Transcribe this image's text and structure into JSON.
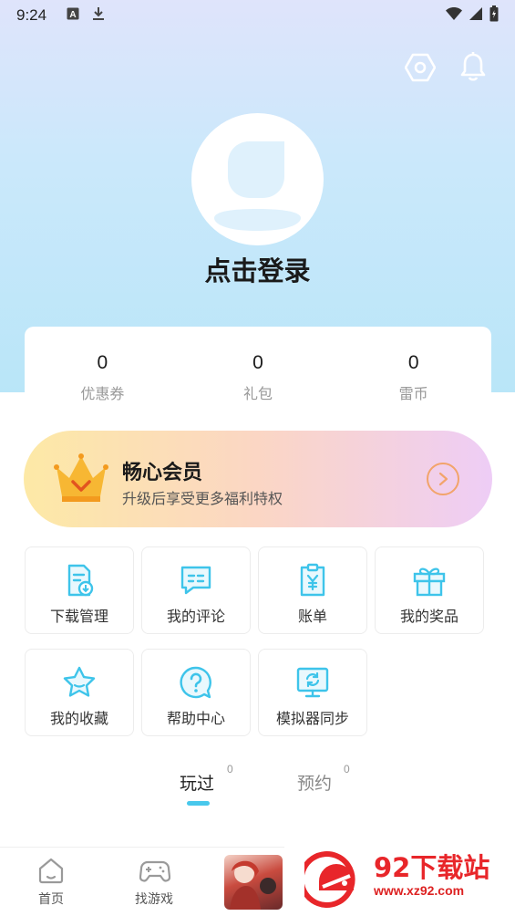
{
  "status_bar": {
    "time": "9:24"
  },
  "icons": {
    "settings": "settings-hex-icon",
    "notification": "bell-icon"
  },
  "profile": {
    "login_label": "点击登录"
  },
  "stats": [
    {
      "value": "0",
      "label": "优惠券"
    },
    {
      "value": "0",
      "label": "礼包"
    },
    {
      "value": "0",
      "label": "雷币"
    }
  ],
  "vip": {
    "title": "畅心会员",
    "subtitle": "升级后享受更多福利特权"
  },
  "menu": [
    {
      "label": "下载管理",
      "icon": "download-doc-icon"
    },
    {
      "label": "我的评论",
      "icon": "comment-icon"
    },
    {
      "label": "账单",
      "icon": "bill-icon"
    },
    {
      "label": "我的奖品",
      "icon": "gift-icon"
    },
    {
      "label": "我的收藏",
      "icon": "star-icon"
    },
    {
      "label": "帮助中心",
      "icon": "help-icon"
    },
    {
      "label": "模拟器同步",
      "icon": "sync-monitor-icon"
    }
  ],
  "tabs": [
    {
      "label": "玩过",
      "count": "0"
    },
    {
      "label": "预约",
      "count": "0"
    }
  ],
  "bottom_nav": [
    {
      "label": "首页",
      "icon": "home-icon"
    },
    {
      "label": "找游戏",
      "icon": "gamepad-icon"
    }
  ],
  "watermark": {
    "title": "92下载站",
    "url": "www.xz92.com"
  },
  "colors": {
    "accent": "#48c8ec",
    "icon_blue": "#3ec4ea",
    "vip_arrow": "#f2a46b",
    "watermark_red": "#e8262a"
  }
}
